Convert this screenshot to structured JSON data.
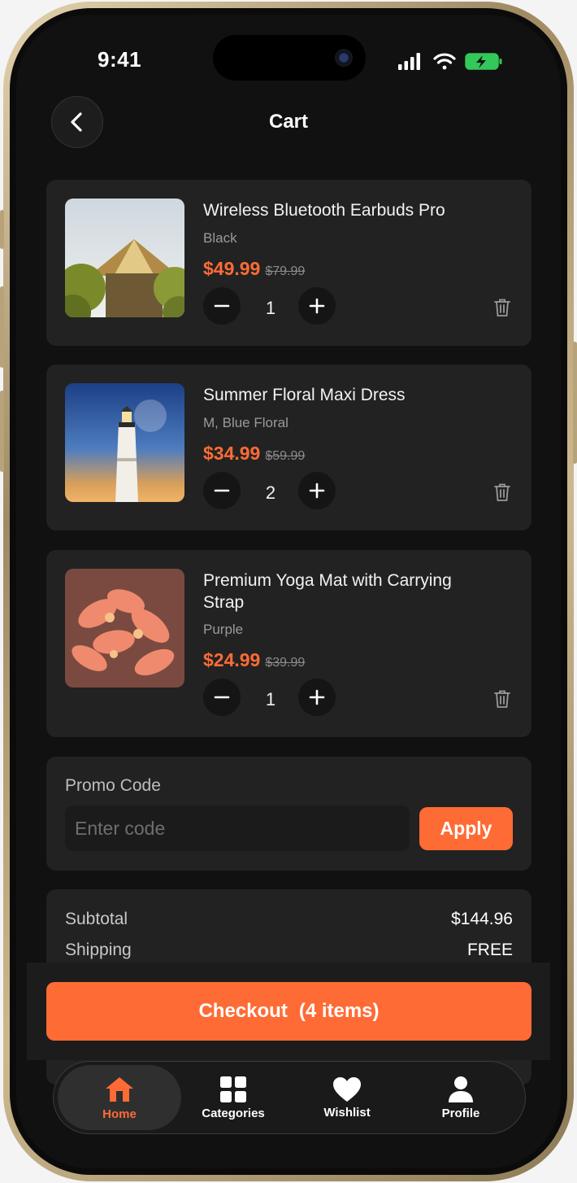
{
  "status_bar": {
    "time": "9:41"
  },
  "header": {
    "title": "Cart"
  },
  "cart": {
    "items": [
      {
        "name": "Wireless Bluetooth Earbuds Pro",
        "variant": "Black",
        "price": "$49.99",
        "original_price": "$79.99",
        "quantity": "1"
      },
      {
        "name": "Summer Floral Maxi Dress",
        "variant": "M, Blue Floral",
        "price": "$34.99",
        "original_price": "$59.99",
        "quantity": "2"
      },
      {
        "name": "Premium Yoga Mat with Carrying Strap",
        "variant": "Purple",
        "price": "$24.99",
        "original_price": "$39.99",
        "quantity": "1"
      }
    ]
  },
  "promo": {
    "label": "Promo Code",
    "placeholder": "Enter code",
    "apply_label": "Apply"
  },
  "summary": {
    "subtotal_label": "Subtotal",
    "subtotal_value": "$144.96",
    "shipping_label": "Shipping",
    "shipping_value": "FREE"
  },
  "checkout": {
    "label": "Checkout",
    "count": "(4 items)"
  },
  "tabbar": {
    "tabs": [
      {
        "label": "Home",
        "icon": "home-icon",
        "active": true
      },
      {
        "label": "Categories",
        "icon": "grid-icon",
        "active": false
      },
      {
        "label": "Wishlist",
        "icon": "heart-icon",
        "active": false
      },
      {
        "label": "Profile",
        "icon": "person-icon",
        "active": false
      }
    ]
  },
  "colors": {
    "accent": "#ff6b35",
    "background": "#111111",
    "card": "#222222"
  }
}
